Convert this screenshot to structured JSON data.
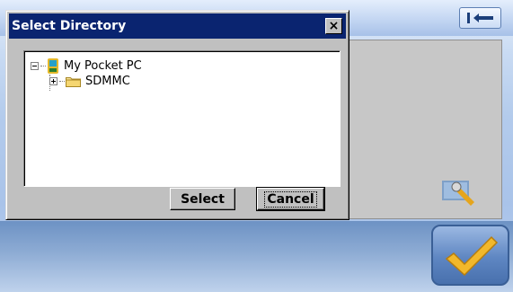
{
  "dialog": {
    "title": "Select Directory",
    "close_label": "×",
    "tree": [
      {
        "label": "My Pocket PC",
        "expander": "minus",
        "icon": "pocket-pc-icon"
      },
      {
        "label": "SDMMC",
        "expander": "plus",
        "icon": "folder-icon"
      }
    ],
    "select_label": "Select",
    "cancel_label": "Cancel"
  },
  "background": {
    "back_icon": "back-arrow-icon",
    "tool_icon": "wrench-icon",
    "ok_icon": "checkmark-icon"
  },
  "colors": {
    "title_bar": "#0a2470",
    "dialog_face": "#c0c0c0",
    "ok_button": "#5e86c2",
    "checkmark": "#f2b82b"
  }
}
